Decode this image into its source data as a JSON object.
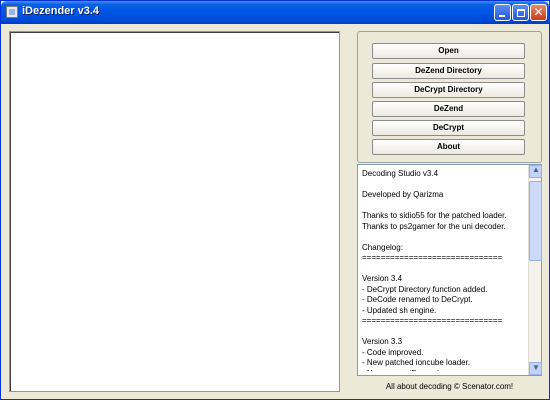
{
  "window": {
    "title": "iDezender v3.4"
  },
  "buttons": {
    "open": "Open",
    "dezend_directory": "DeZend Directory",
    "decrypt_directory": "DeCrypt Directory",
    "dezend": "DeZend",
    "decrypt": "DeCrypt",
    "about": "About"
  },
  "about_text": "Decoding Studio v3.4\n\nDeveloped by Qarizma\n\nThanks to sidio55 for the patched loader.\nThanks to ps2gamer for the uni decoder.\n\nChangelog:\n==============================\n\nVersion 3.4\n- DeCrypt Directory function added.\n- DeCode renamed to DeCrypt.\n- Updated sh engine.\n==============================\n\nVersion 3.3\n- Code improved.\n- New patched ioncube loader.\n- New name: iDezender",
  "footer": "All about decoding © Scenator.com!"
}
